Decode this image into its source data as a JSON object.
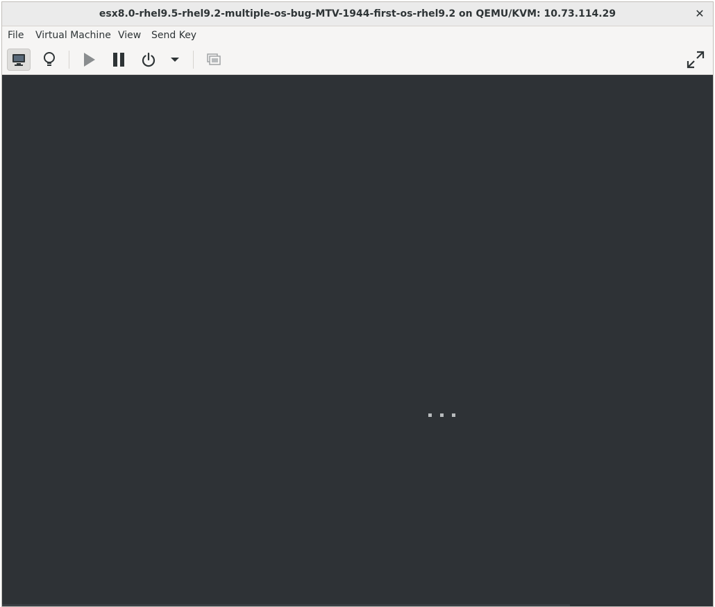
{
  "window": {
    "title": "esx8.0-rhel9.5-rhel9.2-multiple-os-bug-MTV-1944-first-os-rhel9.2 on QEMU/KVM: 10.73.114.29",
    "close_glyph": "✕"
  },
  "menubar": {
    "items": [
      {
        "label": "File"
      },
      {
        "label": "Virtual Machine"
      },
      {
        "label": "View"
      },
      {
        "label": "Send Key"
      }
    ]
  },
  "toolbar": {
    "buttons": [
      {
        "icon": "monitor-icon",
        "state": "active"
      },
      {
        "icon": "lightbulb-icon"
      },
      {
        "icon": "play-icon",
        "state": "disabled"
      },
      {
        "icon": "pause-icon"
      },
      {
        "icon": "power-icon"
      },
      {
        "icon": "chevron-down-icon"
      },
      {
        "icon": "snapshots-icon",
        "state": "disabled"
      },
      {
        "icon": "fullscreen-icon"
      }
    ]
  },
  "console": {
    "background": "#2e3236",
    "status": "loading"
  }
}
